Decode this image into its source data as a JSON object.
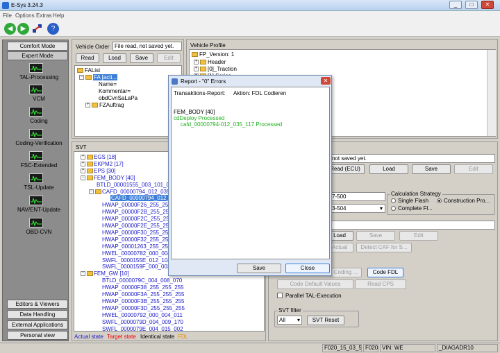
{
  "window": {
    "title": "E-Sys 3.24.3",
    "controls": [
      "_",
      "□",
      "✕"
    ]
  },
  "menu": [
    "File",
    "Options",
    "Extras",
    "Help"
  ],
  "toolbar_icons": [
    "back-icon",
    "forward-icon",
    "network-icon",
    "help-icon"
  ],
  "sidebar": {
    "comfort_mode": "Comfort Mode",
    "expert_mode": "Expert Mode",
    "items": [
      "TAL-Processing",
      "VCM",
      "Coding",
      "Coding-Verification",
      "FSC-Extended",
      "TSL-Update",
      "NAV/ENT-Update",
      "OBD-CVN"
    ],
    "bottom": [
      "Editors & Viewers",
      "Data Handling",
      "External Applications",
      "Personal view"
    ]
  },
  "vehicle_order": {
    "label": "Vehicle Order",
    "status": "File read, not saved yet.",
    "buttons": {
      "read": "Read",
      "load": "Load",
      "save": "Save",
      "edit": "Edit"
    },
    "tree": [
      "FAList",
      "FA [acti...",
      "Name=",
      "Kommentar=",
      "obdCvnSaLaPa",
      "FZAuftrag"
    ]
  },
  "vehicle_profile": {
    "label": "Vehicle Profile",
    "tree": [
      "FP_Version: 1",
      "Header",
      "[0]_Traction",
      "[1] Series"
    ]
  },
  "svt": {
    "label": "SVT",
    "items": [
      {
        "text": "EGS [18]",
        "cls": "blue"
      },
      {
        "text": "EKPM2 [17]",
        "cls": "blue"
      },
      {
        "text": "EPS [30]",
        "cls": "blue"
      },
      {
        "text": "FEM_BODY [40]",
        "cls": "blue"
      },
      {
        "text": "BTLD_00001555_003_101_01",
        "cls": "blue"
      },
      {
        "text": "CAFD_00000794_012_035_11",
        "cls": "blue"
      },
      {
        "text": "CAFD_00000794_012_035",
        "cls": "sel"
      },
      {
        "text": "HWAP_00000F26_255_255_2",
        "cls": "blue"
      },
      {
        "text": "HWAP_00000F2B_255_255_2",
        "cls": "blue"
      },
      {
        "text": "HWAP_00000F2C_255_255_2",
        "cls": "blue"
      },
      {
        "text": "HWAP_00000F2E_255_255_2",
        "cls": "blue"
      },
      {
        "text": "HWAP_00000F30_255_255_2",
        "cls": "blue"
      },
      {
        "text": "HWAP_00000F32_255_255_2",
        "cls": "blue"
      },
      {
        "text": "HWAP_00001263_255_255_2",
        "cls": "blue"
      },
      {
        "text": "HWEL_00000782_000_004_01",
        "cls": "blue"
      },
      {
        "text": "SWFL_0000155E_012_104_0",
        "cls": "blue"
      },
      {
        "text": "SWFL_0000159F_000_003_00",
        "cls": "blue"
      },
      {
        "text": "FEM_GW [10]",
        "cls": "blue"
      },
      {
        "text": "BTLD_0000079C_004_008_070",
        "cls": "blue"
      },
      {
        "text": "HWAP_00000F38_255_255_255",
        "cls": "blue"
      },
      {
        "text": "HWAP_00000F3A_255_255_255",
        "cls": "blue"
      },
      {
        "text": "HWAP_00000F3B_255_255_255",
        "cls": "blue"
      },
      {
        "text": "HWAP_00000F3D_255_255_255",
        "cls": "blue"
      },
      {
        "text": "HWEL_00000792_000_004_011",
        "cls": "blue"
      },
      {
        "text": "SWFL_0000079D_004_009_170",
        "cls": "blue"
      },
      {
        "text": "SWFL_0000079E_004_015_002",
        "cls": "blue"
      }
    ],
    "legend": {
      "actual": "Actual state",
      "target": "Target state",
      "identical": "Identical state",
      "fdl": "FDL"
    }
  },
  "right_panel": {
    "status": "not saved yet.",
    "buttons_row1": {
      "read_ecu": "Read (ECU)",
      "load": "Load",
      "save": "Save",
      "edit": "Edit"
    },
    "field1": "7-500",
    "field2": "3-504",
    "calc_strategy": {
      "title": "Calculation Strategy",
      "single_flash": "Single Flash",
      "construction": "Construction Pro...",
      "complete": "Complete Fl..."
    },
    "buttons_row2": {
      "load": "Load",
      "save": "Save",
      "edit": "Edit"
    },
    "actual": "Actual",
    "detect_caf": "Detect CAF for S...",
    "coding": "Coding ...",
    "code_fdl": "Code FDL",
    "code_default": "Code Default Values",
    "read_cps": "Read CPS",
    "parallel": "Parallel TAL-Execution",
    "svt_filter": {
      "title": "SVT filter",
      "value": "All",
      "reset": "SVT Reset"
    }
  },
  "dialog": {
    "title": "Report - \"0\" Errors",
    "header_left": "Transaktions-Report:",
    "header_right": "Aktion: FDL Codieren",
    "lines": [
      {
        "text": "FEM_BODY [40]",
        "cls": "black"
      },
      {
        "text": "cdDeploy Processed",
        "cls": "green"
      },
      {
        "text": "cafd_00000794-012_035_117 Processed",
        "cls": "green"
      }
    ],
    "save": "Save",
    "close": "Close"
  },
  "statusbar": {
    "field1": "F020_15_03_504",
    "field2": "F020",
    "vin": "VIN: WE",
    "diag": "_DIAGADR10"
  },
  "colors": {
    "accent": "#3c7fd8",
    "green": "#20b020",
    "tree_blue": "#1a1ac8",
    "target_red": "#e00000",
    "fdl_orange": "#e89000"
  }
}
